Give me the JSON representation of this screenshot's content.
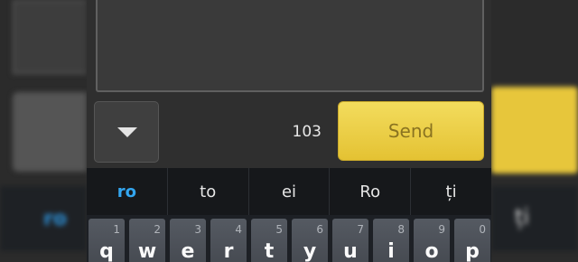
{
  "composer": {
    "char_count": "103",
    "send_label": "Send"
  },
  "suggestions": [
    {
      "label": "ro",
      "primary": true
    },
    {
      "label": "to"
    },
    {
      "label": "ei"
    },
    {
      "label": "Ro"
    },
    {
      "label": "ți"
    }
  ],
  "keyboard": {
    "row1": [
      {
        "num": "1",
        "ch": "q"
      },
      {
        "num": "2",
        "ch": "w"
      },
      {
        "num": "3",
        "ch": "e"
      },
      {
        "num": "4",
        "ch": "r"
      },
      {
        "num": "5",
        "ch": "t"
      },
      {
        "num": "6",
        "ch": "y"
      },
      {
        "num": "7",
        "ch": "u"
      },
      {
        "num": "8",
        "ch": "i"
      },
      {
        "num": "9",
        "ch": "o"
      },
      {
        "num": "0",
        "ch": "p"
      }
    ]
  },
  "colors": {
    "send_bg": "#e7c63b",
    "suggestion_primary": "#33a6f0"
  }
}
